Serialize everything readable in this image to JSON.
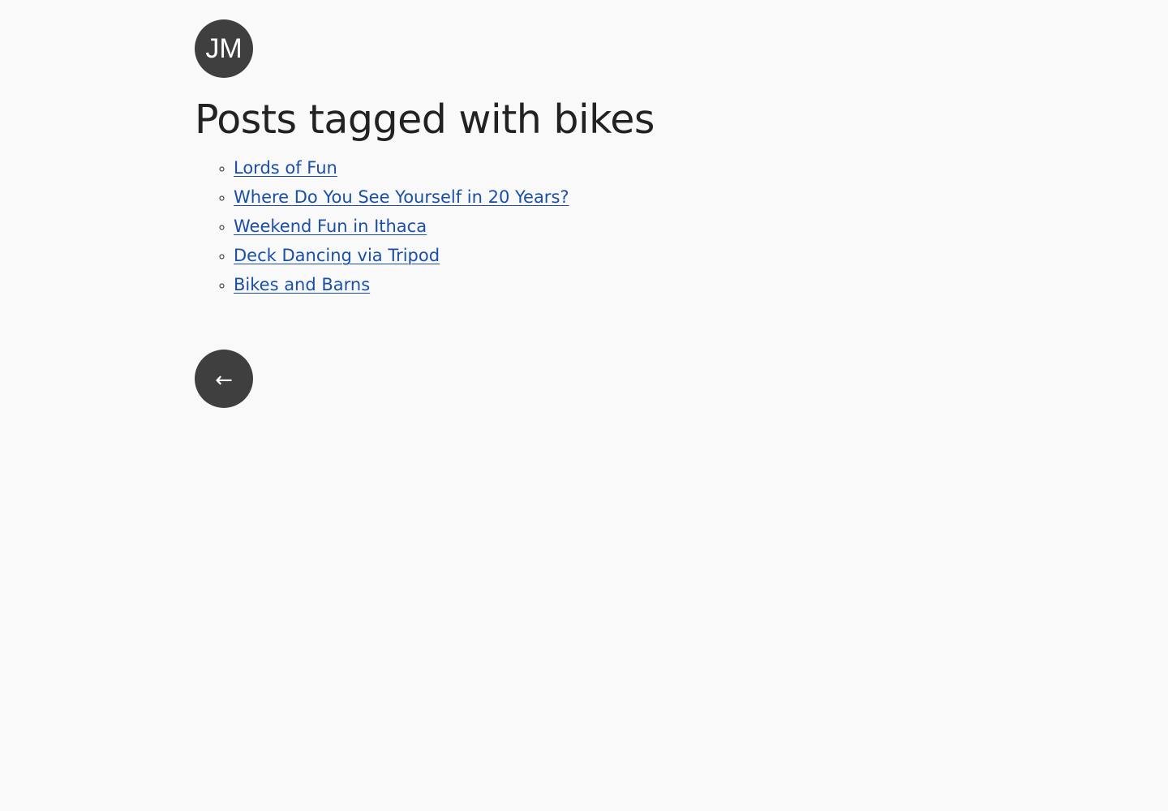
{
  "header": {
    "avatar_initials": "JM"
  },
  "main": {
    "title": "Posts tagged with bikes",
    "posts": [
      {
        "label": "Lords of Fun"
      },
      {
        "label": "Where Do You See Yourself in 20 Years?"
      },
      {
        "label": "Weekend Fun in Ithaca"
      },
      {
        "label": "Deck Dancing via Tripod"
      },
      {
        "label": "Bikes and Barns"
      }
    ]
  },
  "footer": {
    "back_label": "←",
    "back_icon": "arrow-left-icon"
  },
  "colors": {
    "background": "#f9f9f9",
    "text": "#222222",
    "link": "#1a4fa8",
    "badge": "#3f3f3f"
  }
}
